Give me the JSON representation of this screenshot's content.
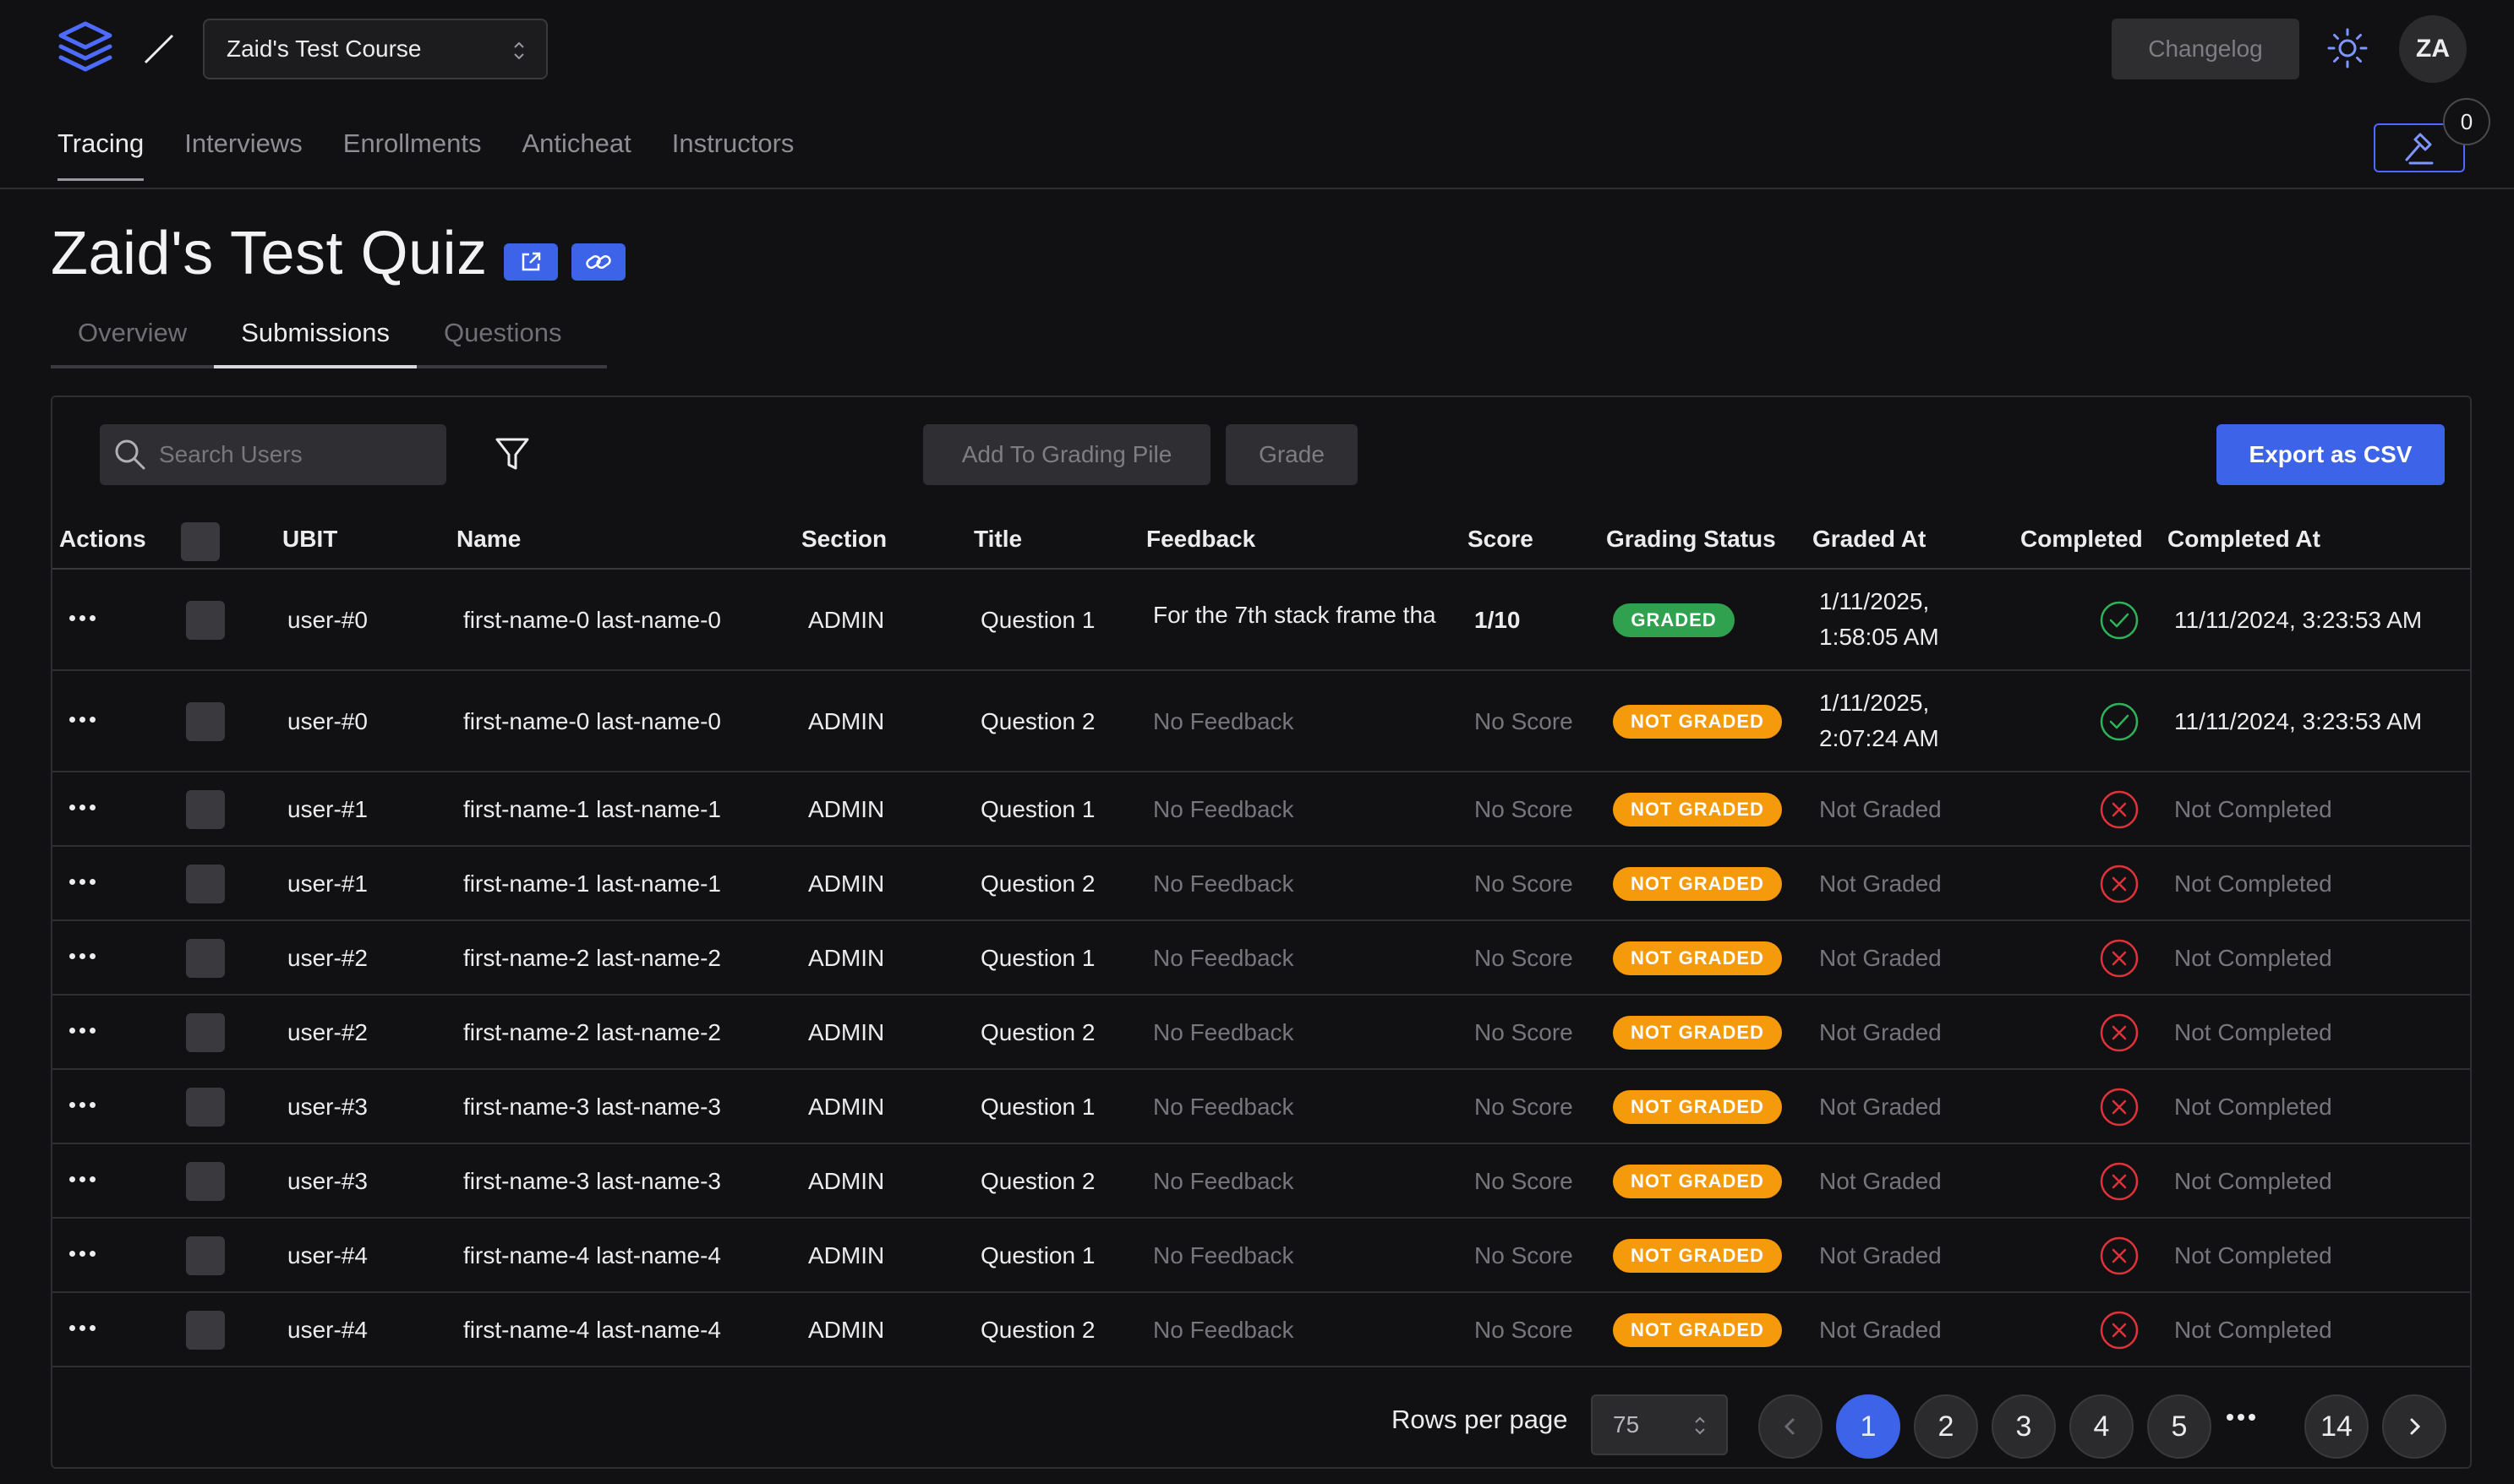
{
  "header": {
    "course_name": "Zaid's Test Course",
    "changelog_label": "Changelog",
    "avatar_initials": "ZA",
    "notification_count": "0"
  },
  "main_tabs": [
    {
      "label": "Tracing",
      "active": true
    },
    {
      "label": "Interviews",
      "active": false
    },
    {
      "label": "Enrollments",
      "active": false
    },
    {
      "label": "Anticheat",
      "active": false
    },
    {
      "label": "Instructors",
      "active": false
    }
  ],
  "quiz": {
    "title": "Zaid's Test Quiz"
  },
  "sub_tabs": [
    {
      "label": "Overview",
      "active": false
    },
    {
      "label": "Submissions",
      "active": true
    },
    {
      "label": "Questions",
      "active": false
    }
  ],
  "toolbar": {
    "search_placeholder": "Search Users",
    "add_to_pile_label": "Add To Grading Pile",
    "grade_label": "Grade",
    "export_label": "Export as CSV"
  },
  "table": {
    "columns": {
      "actions": "Actions",
      "ubit": "UBIT",
      "name": "Name",
      "section": "Section",
      "title": "Title",
      "feedback": "Feedback",
      "score": "Score",
      "grading_status": "Grading Status",
      "graded_at": "Graded At",
      "completed": "Completed",
      "completed_at": "Completed At"
    },
    "rows": [
      {
        "ubit": "user-#0",
        "name": "first-name-0 last-name-0",
        "section": "ADMIN",
        "title": "Question 1",
        "feedback": "For the 7th stack frame tha",
        "score": "1/10",
        "status": "GRADED",
        "graded_at_1": "1/11/2025,",
        "graded_at_2": "1:58:05 AM",
        "completed": true,
        "completed_at": "11/11/2024, 3:23:53 AM"
      },
      {
        "ubit": "user-#0",
        "name": "first-name-0 last-name-0",
        "section": "ADMIN",
        "title": "Question 2",
        "feedback": "No Feedback",
        "score": "No Score",
        "status": "NOT GRADED",
        "graded_at_1": "1/11/2025,",
        "graded_at_2": "2:07:24 AM",
        "completed": true,
        "completed_at": "11/11/2024, 3:23:53 AM"
      },
      {
        "ubit": "user-#1",
        "name": "first-name-1 last-name-1",
        "section": "ADMIN",
        "title": "Question 1",
        "feedback": "No Feedback",
        "score": "No Score",
        "status": "NOT GRADED",
        "graded_at_1": "Not Graded",
        "graded_at_2": "",
        "completed": false,
        "completed_at": "Not Completed"
      },
      {
        "ubit": "user-#1",
        "name": "first-name-1 last-name-1",
        "section": "ADMIN",
        "title": "Question 2",
        "feedback": "No Feedback",
        "score": "No Score",
        "status": "NOT GRADED",
        "graded_at_1": "Not Graded",
        "graded_at_2": "",
        "completed": false,
        "completed_at": "Not Completed"
      },
      {
        "ubit": "user-#2",
        "name": "first-name-2 last-name-2",
        "section": "ADMIN",
        "title": "Question 1",
        "feedback": "No Feedback",
        "score": "No Score",
        "status": "NOT GRADED",
        "graded_at_1": "Not Graded",
        "graded_at_2": "",
        "completed": false,
        "completed_at": "Not Completed"
      },
      {
        "ubit": "user-#2",
        "name": "first-name-2 last-name-2",
        "section": "ADMIN",
        "title": "Question 2",
        "feedback": "No Feedback",
        "score": "No Score",
        "status": "NOT GRADED",
        "graded_at_1": "Not Graded",
        "graded_at_2": "",
        "completed": false,
        "completed_at": "Not Completed"
      },
      {
        "ubit": "user-#3",
        "name": "first-name-3 last-name-3",
        "section": "ADMIN",
        "title": "Question 1",
        "feedback": "No Feedback",
        "score": "No Score",
        "status": "NOT GRADED",
        "graded_at_1": "Not Graded",
        "graded_at_2": "",
        "completed": false,
        "completed_at": "Not Completed"
      },
      {
        "ubit": "user-#3",
        "name": "first-name-3 last-name-3",
        "section": "ADMIN",
        "title": "Question 2",
        "feedback": "No Feedback",
        "score": "No Score",
        "status": "NOT GRADED",
        "graded_at_1": "Not Graded",
        "graded_at_2": "",
        "completed": false,
        "completed_at": "Not Completed"
      },
      {
        "ubit": "user-#4",
        "name": "first-name-4 last-name-4",
        "section": "ADMIN",
        "title": "Question 1",
        "feedback": "No Feedback",
        "score": "No Score",
        "status": "NOT GRADED",
        "graded_at_1": "Not Graded",
        "graded_at_2": "",
        "completed": false,
        "completed_at": "Not Completed"
      },
      {
        "ubit": "user-#4",
        "name": "first-name-4 last-name-4",
        "section": "ADMIN",
        "title": "Question 2",
        "feedback": "No Feedback",
        "score": "No Score",
        "status": "NOT GRADED",
        "graded_at_1": "Not Graded",
        "graded_at_2": "",
        "completed": false,
        "completed_at": "Not Completed"
      }
    ]
  },
  "pagination": {
    "rows_per_page_label": "Rows per page",
    "rows_per_page_value": "75",
    "pages": [
      "1",
      "2",
      "3",
      "4",
      "5"
    ],
    "last_page": "14",
    "current_page": "1"
  },
  "colors": {
    "accent": "#3c63e8",
    "graded": "#30a14e",
    "not_graded": "#f59a0b",
    "completed": "#2fb35a",
    "not_completed": "#e0323a"
  }
}
